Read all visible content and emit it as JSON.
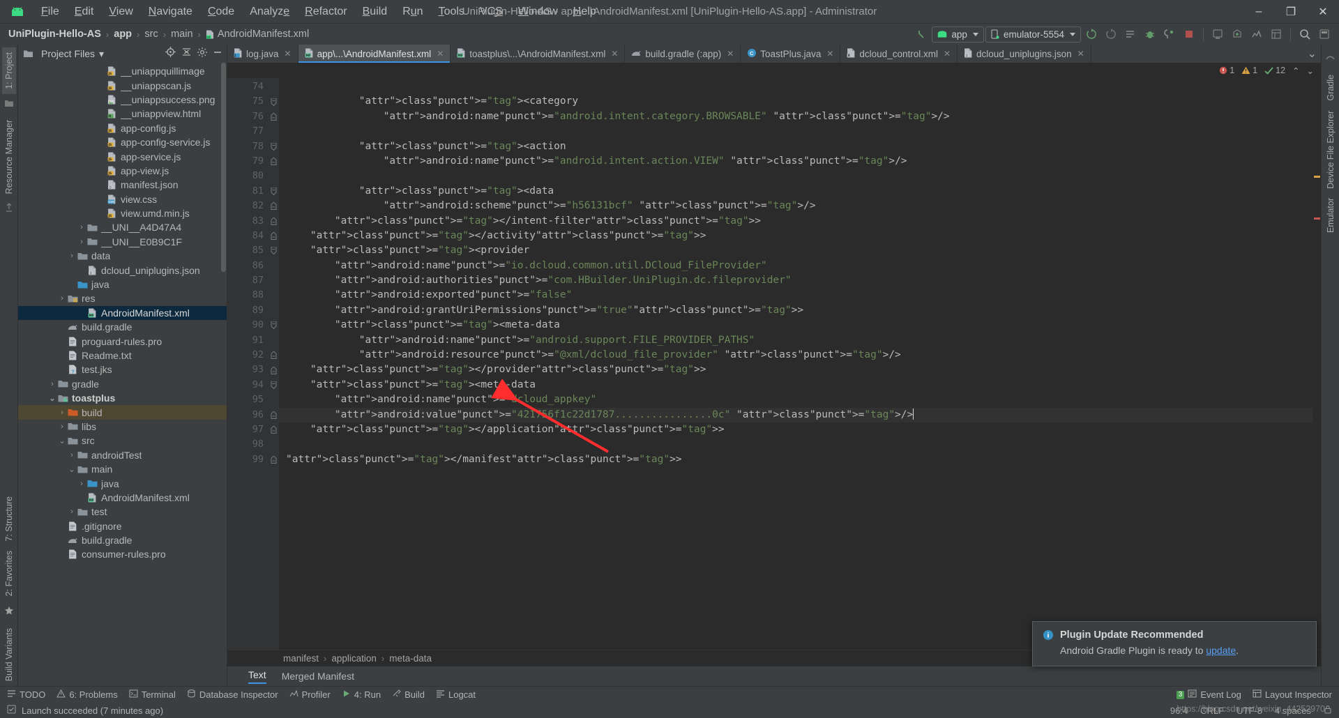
{
  "window": {
    "title": "UniPlugin-Hello-AS - app\\...\\AndroidManifest.xml [UniPlugin-Hello-AS.app] - Administrator",
    "minimize": "–",
    "maximize": "❐",
    "close": "✕"
  },
  "menubar": {
    "items": [
      "File",
      "Edit",
      "View",
      "Navigate",
      "Code",
      "Analyze",
      "Refactor",
      "Build",
      "Run",
      "Tools",
      "VCS",
      "Window",
      "Help"
    ]
  },
  "breadcrumb": {
    "items": [
      "UniPlugin-Hello-AS",
      "app",
      "src",
      "main",
      "AndroidManifest.xml"
    ],
    "separator": "›"
  },
  "toolbar": {
    "run_config": "app",
    "device": "emulator-5554",
    "icons": [
      "sync-gradle-icon",
      "avd-manager-icon",
      "sdk-manager-icon",
      "run-icon",
      "debug-icon",
      "attach-debugger-icon",
      "profile-icon",
      "stop-icon",
      "layout-inspector-icon",
      "device-file-explorer-icon",
      "search-icon"
    ]
  },
  "left_rail": {
    "items": [
      "1: Project",
      "Resource Manager",
      "7: Structure",
      "2: Favorites",
      "Build Variants"
    ]
  },
  "right_rail": {
    "items": [
      "Gradle",
      "Device File Explorer",
      "Emulator"
    ]
  },
  "project_panel": {
    "title": "Project Files",
    "dropdown_caret": "▾",
    "tree": [
      {
        "label": "__uniappquillimage",
        "indent": 7,
        "arrow": "",
        "icon": "js-file-icon"
      },
      {
        "label": "__uniappscan.js",
        "indent": 7,
        "arrow": "",
        "icon": "js-file-icon"
      },
      {
        "label": "__uniappsuccess.png",
        "indent": 7,
        "arrow": "",
        "icon": "image-file-icon"
      },
      {
        "label": "__uniappview.html",
        "indent": 7,
        "arrow": "",
        "icon": "html-file-icon"
      },
      {
        "label": "app-config.js",
        "indent": 7,
        "arrow": "",
        "icon": "js-file-icon"
      },
      {
        "label": "app-config-service.js",
        "indent": 7,
        "arrow": "",
        "icon": "js-file-icon"
      },
      {
        "label": "app-service.js",
        "indent": 7,
        "arrow": "",
        "icon": "js-file-icon"
      },
      {
        "label": "app-view.js",
        "indent": 7,
        "arrow": "",
        "icon": "js-file-icon"
      },
      {
        "label": "manifest.json",
        "indent": 7,
        "arrow": "",
        "icon": "json-file-icon"
      },
      {
        "label": "view.css",
        "indent": 7,
        "arrow": "",
        "icon": "css-file-icon"
      },
      {
        "label": "view.umd.min.js",
        "indent": 7,
        "arrow": "",
        "icon": "js-file-icon"
      },
      {
        "label": "__UNI__A4D47A4",
        "indent": 5,
        "arrow": "›",
        "icon": "folder-icon"
      },
      {
        "label": "__UNI__E0B9C1F",
        "indent": 5,
        "arrow": "›",
        "icon": "folder-icon"
      },
      {
        "label": "data",
        "indent": 4,
        "arrow": "›",
        "icon": "folder-icon"
      },
      {
        "label": "dcloud_uniplugins.json",
        "indent": 5,
        "arrow": "",
        "icon": "json-file-icon"
      },
      {
        "label": "java",
        "indent": 4,
        "arrow": "",
        "icon": "source-folder-icon"
      },
      {
        "label": "res",
        "indent": 3,
        "arrow": "›",
        "icon": "res-folder-icon"
      },
      {
        "label": "AndroidManifest.xml",
        "indent": 5,
        "arrow": "",
        "icon": "manifest-file-icon",
        "state": "selected"
      },
      {
        "label": "build.gradle",
        "indent": 3,
        "arrow": "",
        "icon": "gradle-file-icon"
      },
      {
        "label": "proguard-rules.pro",
        "indent": 3,
        "arrow": "",
        "icon": "text-file-icon"
      },
      {
        "label": "Readme.txt",
        "indent": 3,
        "arrow": "",
        "icon": "text-file-icon"
      },
      {
        "label": "test.jks",
        "indent": 3,
        "arrow": "",
        "icon": "unknown-file-icon"
      },
      {
        "label": "gradle",
        "indent": 2,
        "arrow": "›",
        "icon": "folder-icon"
      },
      {
        "label": "toastplus",
        "indent": 2,
        "arrow": "⌄",
        "icon": "module-icon",
        "state": "bold"
      },
      {
        "label": "build",
        "indent": 3,
        "arrow": "›",
        "icon": "excluded-folder-icon",
        "state": "hover"
      },
      {
        "label": "libs",
        "indent": 3,
        "arrow": "›",
        "icon": "folder-icon"
      },
      {
        "label": "src",
        "indent": 3,
        "arrow": "⌄",
        "icon": "folder-icon"
      },
      {
        "label": "androidTest",
        "indent": 4,
        "arrow": "›",
        "icon": "folder-icon"
      },
      {
        "label": "main",
        "indent": 4,
        "arrow": "⌄",
        "icon": "folder-icon"
      },
      {
        "label": "java",
        "indent": 5,
        "arrow": "›",
        "icon": "source-folder-icon"
      },
      {
        "label": "AndroidManifest.xml",
        "indent": 5,
        "arrow": "",
        "icon": "manifest-file-icon"
      },
      {
        "label": "test",
        "indent": 4,
        "arrow": "›",
        "icon": "folder-icon"
      },
      {
        "label": ".gitignore",
        "indent": 3,
        "arrow": "",
        "icon": "text-file-icon"
      },
      {
        "label": "build.gradle",
        "indent": 3,
        "arrow": "",
        "icon": "gradle-file-icon"
      },
      {
        "label": "consumer-rules.pro",
        "indent": 3,
        "arrow": "",
        "icon": "text-file-icon"
      }
    ]
  },
  "editor_tabs": [
    {
      "label": "log.java",
      "icon": "java-file-icon",
      "active": false
    },
    {
      "label": "app\\...\\AndroidManifest.xml",
      "icon": "manifest-file-icon",
      "active": true
    },
    {
      "label": "toastplus\\...\\AndroidManifest.xml",
      "icon": "manifest-file-icon",
      "active": false
    },
    {
      "label": "build.gradle (:app)",
      "icon": "gradle-file-icon",
      "active": false
    },
    {
      "label": "ToastPlus.java",
      "icon": "class-file-icon",
      "active": false
    },
    {
      "label": "dcloud_control.xml",
      "icon": "xml-file-icon",
      "active": false
    },
    {
      "label": "dcloud_uniplugins.json",
      "icon": "json-file-icon",
      "active": false
    }
  ],
  "inspections": {
    "errors": "1",
    "warnings": "1",
    "weak_warnings": "12",
    "up_arrow": "⌃",
    "down_arrow": "⌄"
  },
  "code": {
    "first_line": 74,
    "cursor_line": 96,
    "lines": [
      {
        "n": 74,
        "fold": "",
        "text": ""
      },
      {
        "n": 75,
        "fold": "minus-down",
        "text": "            <category"
      },
      {
        "n": 76,
        "fold": "minus-up",
        "text": "                android:name=\"android.intent.category.BROWSABLE\" />"
      },
      {
        "n": 77,
        "fold": "",
        "text": ""
      },
      {
        "n": 78,
        "fold": "minus-down",
        "text": "            <action"
      },
      {
        "n": 79,
        "fold": "minus-up",
        "text": "                android:name=\"android.intent.action.VIEW\" />"
      },
      {
        "n": 80,
        "fold": "",
        "text": ""
      },
      {
        "n": 81,
        "fold": "minus-down",
        "text": "            <data"
      },
      {
        "n": 82,
        "fold": "minus-up",
        "text": "                android:scheme=\"h56131bcf\" />"
      },
      {
        "n": 83,
        "fold": "minus-up",
        "text": "        </intent-filter>"
      },
      {
        "n": 84,
        "fold": "minus-up",
        "text": "    </activity>"
      },
      {
        "n": 85,
        "fold": "minus-down",
        "text": "    <provider"
      },
      {
        "n": 86,
        "fold": "",
        "text": "        android:name=\"io.dcloud.common.util.DCloud_FileProvider\""
      },
      {
        "n": 87,
        "fold": "",
        "text": "        android:authorities=\"com.HBuilder.UniPlugin.dc.fileprovider\""
      },
      {
        "n": 88,
        "fold": "",
        "text": "        android:exported=\"false\""
      },
      {
        "n": 89,
        "fold": "",
        "text": "        android:grantUriPermissions=\"true\">"
      },
      {
        "n": 90,
        "fold": "minus-down",
        "text": "        <meta-data"
      },
      {
        "n": 91,
        "fold": "",
        "text": "            android:name=\"android.support.FILE_PROVIDER_PATHS\""
      },
      {
        "n": 92,
        "fold": "minus-up",
        "text": "            android:resource=\"@xml/dcloud_file_provider\" />"
      },
      {
        "n": 93,
        "fold": "minus-up",
        "text": "    </provider>"
      },
      {
        "n": 94,
        "fold": "minus-down",
        "text": "    <meta-data"
      },
      {
        "n": 95,
        "fold": "",
        "text": "        android:name=\"dcloud_appkey\""
      },
      {
        "n": 96,
        "fold": "minus-up",
        "text": "        android:value=\"421756f1c22d1787................0c\" />"
      },
      {
        "n": 97,
        "fold": "minus-up",
        "text": "    </application>"
      },
      {
        "n": 98,
        "fold": "",
        "text": ""
      },
      {
        "n": 99,
        "fold": "minus-up",
        "text": "</manifest>"
      }
    ]
  },
  "editor_breadcrumb": {
    "items": [
      "manifest",
      "application",
      "meta-data"
    ],
    "separator": "›"
  },
  "editor_view_tabs": [
    {
      "label": "Text",
      "active": true
    },
    {
      "label": "Merged Manifest",
      "active": false
    }
  ],
  "bottom_bar": {
    "left": [
      {
        "label": "TODO",
        "icon": "todo-icon"
      },
      {
        "label": "6: Problems",
        "icon": "problems-icon"
      },
      {
        "label": "Terminal",
        "icon": "terminal-icon"
      },
      {
        "label": "Database Inspector",
        "icon": "database-icon"
      },
      {
        "label": "Profiler",
        "icon": "profiler-icon"
      },
      {
        "label": "4: Run",
        "icon": "run-icon"
      },
      {
        "label": "Build",
        "icon": "build-icon"
      },
      {
        "label": "Logcat",
        "icon": "logcat-icon"
      }
    ],
    "right": [
      {
        "label": "Event Log",
        "icon": "event-log-icon",
        "count": "3"
      },
      {
        "label": "Layout Inspector",
        "icon": "layout-inspector-icon"
      }
    ]
  },
  "status_bar": {
    "message": "Launch succeeded (7 minutes ago)",
    "caret_position": "96:4",
    "line_separator": "CRLF",
    "encoding": "UTF-8",
    "indent": "4 spaces"
  },
  "notification": {
    "title": "Plugin Update Recommended",
    "body_prefix": "Android Gradle Plugin is ready to ",
    "link": "update",
    "body_suffix": ".",
    "icon": "info-icon"
  },
  "watermark": "https://blog.csdn.net/weixin_44252970",
  "colors": {
    "accent": "#3c95e8",
    "selection": "#0d293e",
    "editor_bg": "#2b2b2b",
    "chrome_bg": "#3c3f41",
    "tag": "#e8bf6a",
    "attr": "#9876aa",
    "string": "#6a8759",
    "arrow_annotation": "#ff2d2d"
  }
}
